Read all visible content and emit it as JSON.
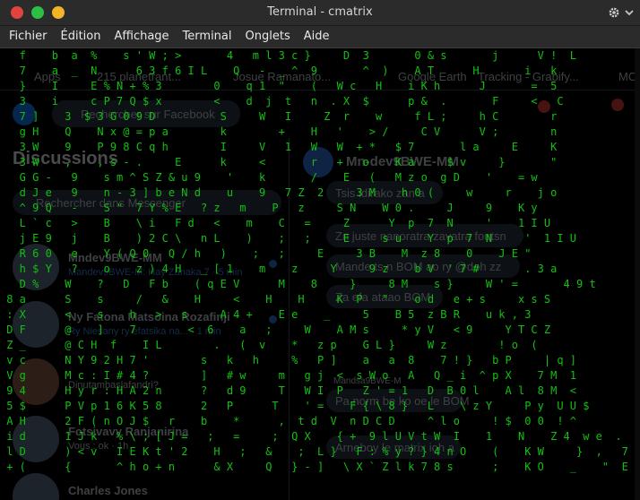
{
  "window": {
    "title": "Terminal - cmatrix"
  },
  "titlebar_icons": [
    "gear-icon",
    "chevron-down-icon"
  ],
  "menu": [
    "Fichier",
    "Édition",
    "Affichage",
    "Terminal",
    "Onglets",
    "Aide"
  ],
  "background": {
    "bookmarks": [
      "Apps",
      "215 planetrant...",
      "Josue Ramanato...",
      "Google Earth",
      "Tracking - Grabify...",
      "MC"
    ],
    "search_placeholder": "Rechercher sur Facebook",
    "discussions_title": "Discussions",
    "search_messenger": "Rechercher dans Messenger",
    "contact1_name": "Mndev9BWE-MM",
    "contact1_preview": "Mandev9BWE-M: Hay Zanaka 7 · 5 min",
    "contact2_name": "Ny Fatona Matsoina Rozafinji",
    "contact2_preview": "Ry Niesany ry efatsika na... · 1 min",
    "contact3_name": "Dinutambaslafandri?",
    "contact3_preview": "Dinutambaslafandri? · 9 min",
    "contact4_name": "Fotsivavy Ranjanirina",
    "contact4_preview": "Vous : ok · 1h",
    "contact5_name": "Charles Jones",
    "chat_title": "Mn-dev9BWE-MM",
    "chat_messages": [
      "Tsis idirako zan a",
      "Zn juste nanoratra zavatra foutsn",
      "Mande ts n BOM ao ry @doh zz",
      "Za efa ataao BOM",
      "Pa norm be ko oe le BOM",
      "Arneboy le matrix ioh a"
    ],
    "chat_sender": "Mandsa9BWE-M"
  },
  "matrix_lines": [
    "   f    b  a  %    s ' W ; >       4   m l 3 c }     D  3       0 & s       j      V !  L",
    "   7    a  _  N      6 3 f 6 I L    Q   -  _ ^  9       ^  )    A T      H       i   k",
    "   }    I     E % N + % 3        0    q 1  \"    (   W c   H    i K h      J       =  5",
    "   3    i     c P 7 Q $ x        <    d  j  t   n  . X  $      p &  .       F     <   C",
    "   7 ]    3  $ 3 G 0 9 D          S     W   I     Z  r    w     f L ;     h C        r",
    "   g H    Q    N x @ = p a        k        +    H   '    > /     C V      V ;        n",
    "   3 W    9    P 9 8 C q h        I     V   1   W   W  + *   $ 7       l a     E     K",
    "   3 W    ,    , s - .     E      k     <       r   +   o    K a     $ v     }       \"",
    "   G G -   9    s m ^ S Z & u 9    '    k       /    E   (   M z o  g D    '    = w",
    "   d J e   9    n - 3 ] b e N d    u    9   7 Z  2     3 M    h 0 (     w     r    j o",
    "   ^ 9 Q   -    S \"  7 Y % E   ? z   m    P   z     S N    W 0 .     J     9    K y",
    "   L ` c   >    B    \\ i   F d   <    m    C   =     Z      Y  p  7  N     '    1 I U",
    "   j E 9   j    B    ) 2 C \\   n L    )    ;   ;     E     s u    Y  p  7  N     '  1 I U",
    "   R 6 0   e    Y ( Q 0   Q / h   )    ;   ;     E     3 B    M  z 8    0    J E \"",
    "   h $ Y   ?    o    z ) 4 H   _ [ 1    m    z     Y     9 z    b V  ' 7 #       . 3 a",
    "   D %    W    ?   D   F b    ( q E V      M    8     }     8 M    s }     W ' =       4 9 t",
    " 8 a      S    s     /   &    H     <    H    H     K  P   \"    o d   e + s     x s S",
    " : X      <    s    h   >   s     A 4 +    E e    _     5    B 5  z B R    u k , 3",
    " D F      @    ]    7        <  6    a   ;     W    A M s     * y V   < 9     Y T C Z",
    " Z _      @ C H  f    I L        .   (  v    *   z p    G L }     W z        ! o  (",
    " v c      N Y 9 2 H 7 '        s   k   h     %   P ]    a   a  8    7 ! }   b P     | q ]",
    " V g      M c : I # 4 ?        ]   # w     m   g j  <  s W o   A   Q _ i  ^ p X    7 M  1",
    " 9 4      H y r : H A 2 n      ?   d 9     T   W I  P   Z ' = 1   D  B 0 l    A l  8 M  <",
    " 5 $      P V p 1 6 K 5 8      2   P      T    ' =    F { \\ 8 }   L    \\ z Y     P y  U U $",
    " A H      2 F ( n O J $   r    b    *      ,  t d  V  n D C D     ^ l o     ! $  0 0  ! ^",
    " i d      1 J k   % \\ ; [ J =   ;   =     ;  Q X    { +  9 l U V t W  I    1    N    Z 4  w e  .",
    " l D      ) < v   I E K t ' 2    H   ;   &    ;  L }   F : % y ? } 4 n O    (    K W     }  ,   7",
    " + (      {       ^ h o + n      & X     Q   } - ]   \\ X ` Z l k 7 8 s      ;    K O    _    \"  E"
  ]
}
